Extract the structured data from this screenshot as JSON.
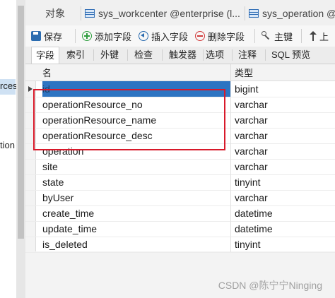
{
  "left_pane": {
    "fragments": [
      "rces",
      "tion"
    ]
  },
  "tabs": [
    {
      "label": "对象",
      "icon": ""
    },
    {
      "label": "sys_workcenter @enterprise (l...",
      "icon": "table-icon"
    },
    {
      "label": "sys_operation @",
      "icon": "table-icon"
    }
  ],
  "toolbar": {
    "save": "保存",
    "add_field": "添加字段",
    "insert_field": "插入字段",
    "delete_field": "删除字段",
    "primary_key": "主键",
    "move_up": "上"
  },
  "subtabs": [
    "字段",
    "索引",
    "外键",
    "检查",
    "触发器",
    "选项",
    "注释",
    "SQL 预览"
  ],
  "grid": {
    "columns": {
      "name": "名",
      "type": "类型"
    },
    "rows": [
      {
        "name": "id",
        "type": "bigint"
      },
      {
        "name": "operationResource_no",
        "type": "varchar"
      },
      {
        "name": "operationResource_name",
        "type": "varchar"
      },
      {
        "name": "operationResource_desc",
        "type": "varchar"
      },
      {
        "name": "operation",
        "type": "varchar"
      },
      {
        "name": "site",
        "type": "varchar"
      },
      {
        "name": "state",
        "type": "tinyint"
      },
      {
        "name": "byUser",
        "type": "varchar"
      },
      {
        "name": "create_time",
        "type": "datetime"
      },
      {
        "name": "update_time",
        "type": "datetime"
      },
      {
        "name": "is_deleted",
        "type": "tinyint"
      }
    ]
  },
  "watermark": "CSDN @陈宁宁Ninging",
  "colors": {
    "selection": "#2d74c2",
    "annotation": "#d8192a"
  }
}
